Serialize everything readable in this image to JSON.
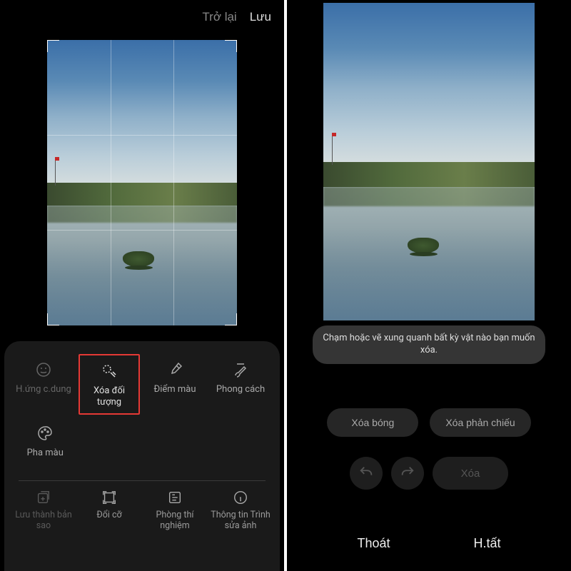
{
  "left": {
    "topbar": {
      "back": "Trở lại",
      "save": "Lưu"
    },
    "tools": [
      {
        "name": "portrait-effect",
        "label": "H.ứng c.dung",
        "icon": "face",
        "dim": true
      },
      {
        "name": "remove-object",
        "label": "Xóa đối tượng",
        "icon": "eraser",
        "active": true,
        "highlight": true
      },
      {
        "name": "color-spot",
        "label": "Điểm màu",
        "icon": "dropper"
      },
      {
        "name": "style",
        "label": "Phong cách",
        "icon": "brush"
      }
    ],
    "tools2": [
      {
        "name": "color-mix",
        "label": "Pha màu",
        "icon": "palette"
      }
    ],
    "bottom_tools": [
      {
        "name": "save-copy",
        "label": "Lưu thành bản sao",
        "icon": "savecopy",
        "dim": true
      },
      {
        "name": "resize",
        "label": "Đổi cỡ",
        "icon": "resize"
      },
      {
        "name": "labs",
        "label": "Phòng thí nghiệm",
        "icon": "labs"
      },
      {
        "name": "editor-info",
        "label": "Thông tin Trình sửa ảnh",
        "icon": "info"
      }
    ]
  },
  "right": {
    "tip": "Chạm hoặc vẽ xung quanh bất kỳ vật nào bạn muốn xóa.",
    "actions": {
      "remove_shadow": "Xóa bóng",
      "remove_reflection": "Xóa phản chiếu",
      "erase": "Xóa"
    },
    "bottombar": {
      "exit": "Thoát",
      "done": "H.tất"
    }
  }
}
